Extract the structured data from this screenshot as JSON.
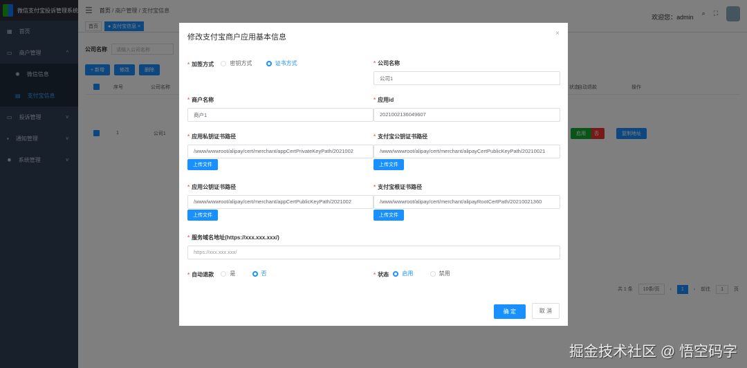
{
  "app": {
    "title": "微信支付宝投诉管理系统"
  },
  "sidebar": {
    "items": [
      {
        "label": "首页"
      },
      {
        "label": "商户管理"
      },
      {
        "label": "微信信息"
      },
      {
        "label": "支付宝信息"
      },
      {
        "label": "投诉管理"
      },
      {
        "label": "通知管理"
      },
      {
        "label": "系统管理"
      }
    ]
  },
  "header": {
    "breadcrumb": [
      "首页",
      "商户管理",
      "支付宝信息"
    ],
    "welcome": "欢迎您：admin"
  },
  "tags": [
    "首页",
    "支付宝信息"
  ],
  "search": {
    "label": "公司名称",
    "placeholder": "请输入公司名称"
  },
  "toolbar": {
    "add": "+ 新增",
    "edit": "修改",
    "delete": "删除"
  },
  "table": {
    "headers": [
      "序号",
      "公司名称",
      "自动退款",
      "状态",
      "操作"
    ],
    "row": {
      "index": "1",
      "company": "公司1",
      "auto_refund": "否",
      "status": "启用",
      "action": "复制地址"
    }
  },
  "pagination": {
    "total": "共 1 条",
    "page_size": "10条/页",
    "current": "1",
    "goto_label": "前往",
    "goto_value": "1",
    "page_suffix": "页"
  },
  "dialog": {
    "title": "修改支付宝商户应用基本信息",
    "sign_label": "加签方式",
    "sign_options": [
      "密钥方式",
      "证书方式"
    ],
    "company_label": "公司名称",
    "company_value": "公司1",
    "merchant_label": "商户名称",
    "merchant_value": "商户1",
    "appid_label": "应用id",
    "appid_value": "2021002136049607",
    "app_private_label": "应用私钥证书路径",
    "app_private_value": "/www/wwwroot/alipay/cert/merchant/appCertPrivateKeyPath/2021002",
    "ali_public_label": "支付宝公钥证书路径",
    "ali_public_value": "/www/wwwroot/alipay/cert/merchant/alipayCertPublicKeyPath/20210021",
    "app_public_label": "应用公钥证书路径",
    "app_public_value": "/www/wwwroot/alipay/cert/merchant/appCertPublicKeyPath/2021002",
    "ali_root_label": "支付宝根证书路径",
    "ali_root_value": "/www/wwwroot/alipay/cert/merchant/alipayRootCertPath/20210021360",
    "upload": "上传文件",
    "domain_label": "服务域名地址(https://xxx.xxx.xxx/)",
    "domain_placeholder": "https://xxx.xxx.xxx/",
    "refund_label": "自动退款",
    "refund_options": [
      "是",
      "否"
    ],
    "status_label": "状态",
    "status_options": [
      "启用",
      "禁用"
    ],
    "ok": "确 定",
    "cancel": "取 消"
  },
  "watermark": "掘金技术社区 @ 悟空码字"
}
